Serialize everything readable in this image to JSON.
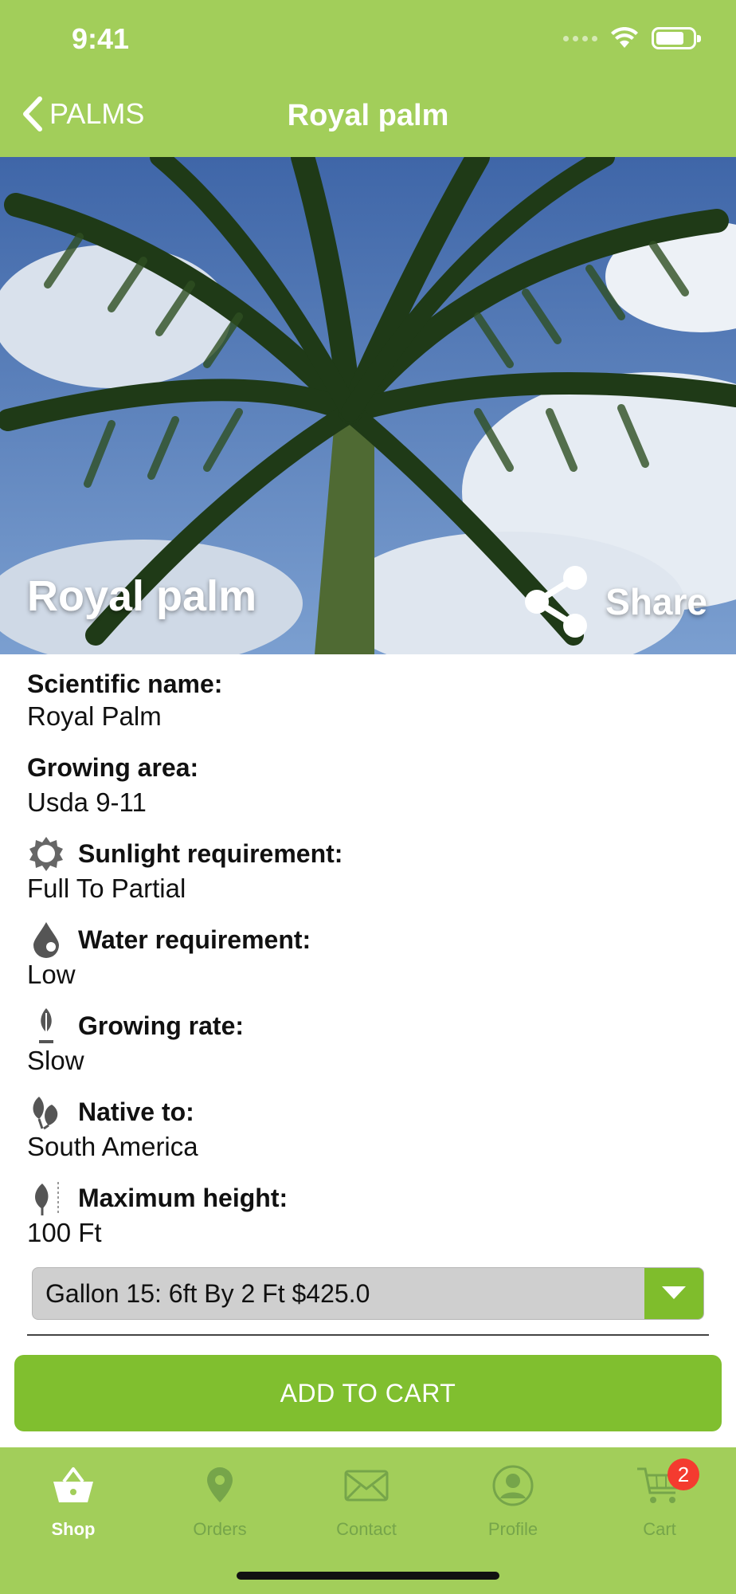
{
  "status_bar": {
    "time": "9:41"
  },
  "nav": {
    "back_label": "PALMS",
    "title": "Royal palm"
  },
  "hero": {
    "title": "Royal palm",
    "share_label": "Share"
  },
  "details": [
    {
      "label": "Scientific name:",
      "value": "Royal Palm",
      "icon": "none"
    },
    {
      "label": "Growing area:",
      "value": "Usda 9-11",
      "icon": "none"
    },
    {
      "label": "Sunlight requirement:",
      "value": "Full To Partial",
      "icon": "sun-icon"
    },
    {
      "label": "Water requirement:",
      "value": "Low",
      "icon": "water-drop-icon"
    },
    {
      "label": "Growing rate:",
      "value": "Slow",
      "icon": "growing-rate-icon"
    },
    {
      "label": "Native to:",
      "value": "South America",
      "icon": "leaves-icon"
    },
    {
      "label": "Maximum height:",
      "value": "100 Ft",
      "icon": "plant-height-icon"
    }
  ],
  "size_select": {
    "selected": "Gallon 15: 6ft By 2 Ft $425.0"
  },
  "add_to_cart": {
    "label": "ADD TO CART"
  },
  "tabs": [
    {
      "label": "Shop",
      "icon": "basket-icon",
      "active": true
    },
    {
      "label": "Orders",
      "icon": "location-pin-icon",
      "active": false
    },
    {
      "label": "Contact",
      "icon": "envelope-icon",
      "active": false
    },
    {
      "label": "Profile",
      "icon": "profile-icon",
      "active": false
    },
    {
      "label": "Cart",
      "icon": "cart-icon",
      "active": false,
      "badge": "2"
    }
  ],
  "colors": {
    "brand_green": "#a2ce5a",
    "button_green": "#80bf2f",
    "badge_red": "#f43b2f"
  }
}
